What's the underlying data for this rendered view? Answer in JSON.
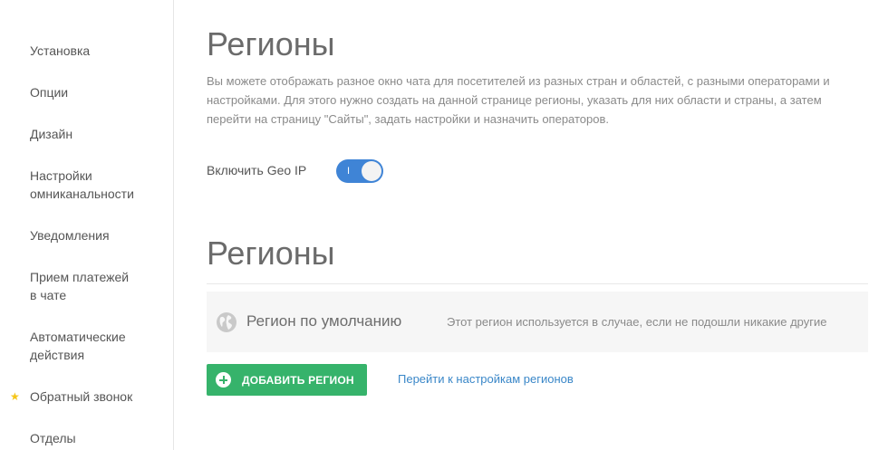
{
  "sidebar": {
    "items": [
      {
        "label": "Установка"
      },
      {
        "label": "Опции"
      },
      {
        "label": "Дизайн"
      },
      {
        "label": "Настройки\nомниканальности"
      },
      {
        "label": "Уведомления"
      },
      {
        "label": "Прием платежей\nв чате"
      },
      {
        "label": "Автоматические\nдействия"
      },
      {
        "label": "Обратный звонок",
        "starred": true
      },
      {
        "label": "Отделы"
      }
    ],
    "star_icon": "star-icon",
    "star_color": "#f5c518"
  },
  "main": {
    "title": "Регионы",
    "description": "Вы можете отображать разное окно чата для посетителей из разных стран и областей, с разными операторами и настройками. Для этого нужно создать на данной странице регионы, указать для них области и страны, а затем перейти на страницу \"Сайты\", задать настройки и назначить операторов.",
    "geo_ip": {
      "label": "Включить Geo IP",
      "toggle_mark": "I",
      "enabled": true,
      "toggle_color": "#3f84d6"
    },
    "regions_section": {
      "title": "Регионы",
      "default_region": {
        "icon": "globe-icon",
        "name": "Регион по умолчанию",
        "description": "Этот регион используется в случае, если не подошли никакие другие"
      },
      "add_button_label": "ДОБАВИТЬ РЕГИОН",
      "add_button_icon": "plus-circle-icon",
      "add_button_color": "#36b36b",
      "settings_link": "Перейти к настройкам регионов",
      "link_color": "#3a87c8"
    }
  }
}
